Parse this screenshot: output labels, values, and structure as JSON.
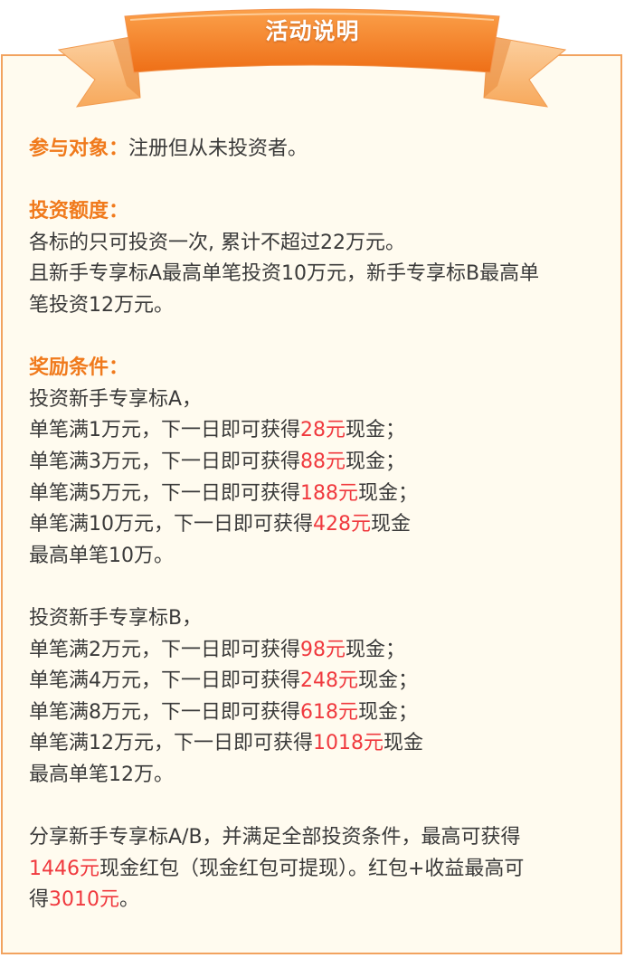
{
  "colors": {
    "accent_orange": "#f07a1c",
    "highlight_red": "#f0393e",
    "panel_bg": "#fffbef",
    "panel_border": "#f2a35f",
    "text": "#3a3a3a"
  },
  "header": {
    "title": "活动说明"
  },
  "target": {
    "label": "参与对象：",
    "value": "注册但从未投资者。"
  },
  "quota": {
    "label": "投资额度：",
    "line1": "各标的只可投资一次, 累计不超过22万元。",
    "line2": "且新手专享标A最高单笔投资10万元，新手专享标B最高单",
    "line3": "笔投资12万元。"
  },
  "rewards": {
    "label": "奖励条件：",
    "a": {
      "title": "投资新手专享标A，",
      "rows": [
        {
          "pre": "单笔满1万元，下一日即可获得",
          "amount": "28元",
          "post": "现金；"
        },
        {
          "pre": "单笔满3万元，下一日即可获得",
          "amount": "88元",
          "post": "现金；"
        },
        {
          "pre": "单笔满5万元，下一日即可获得",
          "amount": "188元",
          "post": "现金；"
        },
        {
          "pre": "单笔满10万元，下一日即可获得",
          "amount": "428元",
          "post": "现金"
        }
      ],
      "max": "最高单笔10万。"
    },
    "b": {
      "title": "投资新手专享标B，",
      "rows": [
        {
          "pre": "单笔满2万元，下一日即可获得",
          "amount": "98元",
          "post": "现金；"
        },
        {
          "pre": "单笔满4万元，下一日即可获得",
          "amount": "248元",
          "post": "现金；"
        },
        {
          "pre": "单笔满8万元，下一日即可获得",
          "amount": "618元",
          "post": "现金；"
        },
        {
          "pre": "单笔满12万元，下一日即可获得",
          "amount": "1018元",
          "post": "现金"
        }
      ],
      "max": "最高单笔12万。"
    }
  },
  "share": {
    "line1": "分享新手专享标A/B，并满足全部投资条件，最高可获得",
    "line2_amount": "1446元",
    "line2_rest": "现金红包（现金红包可提现）。红包+收益最高可",
    "line3_pre": "得",
    "line3_amount": "3010元",
    "line3_post": "。"
  }
}
